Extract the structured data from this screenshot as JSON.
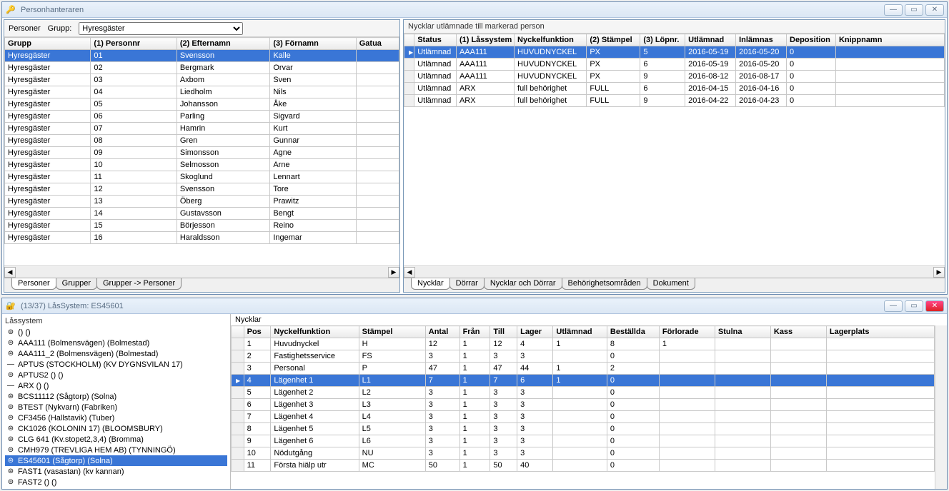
{
  "top_window": {
    "title": "Personhanteraren",
    "toolbar": {
      "personer_label": "Personer",
      "grupp_label": "Grupp:",
      "grupp_selected": "Hyresgäster"
    },
    "persons_table": {
      "headers": [
        "Grupp",
        "(1) Personnr",
        "(2) Efternamn",
        "(3) Förnamn",
        "Gatua"
      ],
      "rows": [
        [
          "Hyresgäster",
          "01",
          "Svensson",
          "Kalle",
          ""
        ],
        [
          "Hyresgäster",
          "02",
          "Bergmark",
          "Orvar",
          ""
        ],
        [
          "Hyresgäster",
          "03",
          "Axbom",
          "Sven",
          ""
        ],
        [
          "Hyresgäster",
          "04",
          "Liedholm",
          "Nils",
          ""
        ],
        [
          "Hyresgäster",
          "05",
          "Johansson",
          "Åke",
          ""
        ],
        [
          "Hyresgäster",
          "06",
          "Parling",
          "Sigvard",
          ""
        ],
        [
          "Hyresgäster",
          "07",
          "Hamrin",
          "Kurt",
          ""
        ],
        [
          "Hyresgäster",
          "08",
          "Gren",
          "Gunnar",
          ""
        ],
        [
          "Hyresgäster",
          "09",
          "Simonsson",
          "Agne",
          ""
        ],
        [
          "Hyresgäster",
          "10",
          "Selmosson",
          "Arne",
          ""
        ],
        [
          "Hyresgäster",
          "11",
          "Skoglund",
          "Lennart",
          ""
        ],
        [
          "Hyresgäster",
          "12",
          "Svensson",
          "Tore",
          ""
        ],
        [
          "Hyresgäster",
          "13",
          "Öberg",
          "Prawitz",
          ""
        ],
        [
          "Hyresgäster",
          "14",
          "Gustavsson",
          "Bengt",
          ""
        ],
        [
          "Hyresgäster",
          "15",
          "Börjesson",
          "Reino",
          ""
        ],
        [
          "Hyresgäster",
          "16",
          "Haraldsson",
          "Ingemar",
          ""
        ]
      ],
      "selected": 0
    },
    "left_tabs": [
      "Personer",
      "Grupper",
      "Grupper -> Personer"
    ],
    "right_title": "Nycklar utlämnade till markerad person",
    "keys_table": {
      "headers": [
        "Status",
        "(1) Låssystem",
        "Nyckelfunktion",
        "(2) Stämpel",
        "(3) Löpnr.",
        "Utlämnad",
        "Inlämnas",
        "Deposition",
        "Knippnamn"
      ],
      "rows": [
        [
          "Utlämnad",
          "AAA111",
          "HUVUDNYCKEL",
          "PX",
          "5",
          "2016-05-19",
          "2016-05-20",
          "0",
          ""
        ],
        [
          "Utlämnad",
          "AAA111",
          "HUVUDNYCKEL",
          "PX",
          "6",
          "2016-05-19",
          "2016-05-20",
          "0",
          ""
        ],
        [
          "Utlämnad",
          "AAA111",
          "HUVUDNYCKEL",
          "PX",
          "9",
          "2016-08-12",
          "2016-08-17",
          "0",
          ""
        ],
        [
          "Utlämnad",
          "ARX",
          "full behörighet",
          "FULL",
          "6",
          "2016-04-15",
          "2016-04-16",
          "0",
          ""
        ],
        [
          "Utlämnad",
          "ARX",
          "full behörighet",
          "FULL",
          "9",
          "2016-04-22",
          "2016-04-23",
          "0",
          ""
        ]
      ],
      "selected": 0
    },
    "right_tabs": [
      "Nycklar",
      "Dörrar",
      "Nycklar och Dörrar",
      "Behörighetsområden",
      "Dokument"
    ]
  },
  "bottom_window": {
    "title": "(13/37) LåsSystem: ES45601",
    "tree": {
      "header": "Låssystem",
      "items": [
        {
          "g": "⊜",
          "label": "() ()"
        },
        {
          "g": "⊜",
          "label": "AAA111 (Bolmensvägen) (Bolmestad)"
        },
        {
          "g": "⊜",
          "label": "AAA111_2 (Bolmensvägen) (Bolmestad)"
        },
        {
          "g": "—",
          "label": "APTUS (STOCKHOLM) (KV DYGNSVILAN 17)"
        },
        {
          "g": "⊜",
          "label": "APTUS2 () ()"
        },
        {
          "g": "—",
          "label": "ARX () ()"
        },
        {
          "g": "⊜",
          "label": "BCS11112 (Sågtorp) (Solna)"
        },
        {
          "g": "⊜",
          "label": "BTEST (Nykvarn) (Fabriken)"
        },
        {
          "g": "⊜",
          "label": "CF3456 (Hallstavik) (Tuber)"
        },
        {
          "g": "⊜",
          "label": "CK1026 (KOLONIN 17) (BLOOMSBURY)"
        },
        {
          "g": "⊜",
          "label": "CLG 641 (Kv.stopet2,3,4) (Bromma)"
        },
        {
          "g": "⊜",
          "label": "CMH979 (TREVLIGA HEM AB) (TYNNINGÖ)"
        },
        {
          "g": "⊜",
          "label": "ES45601 (Sågtorp) (Solna)"
        },
        {
          "g": "⊜",
          "label": "FAST1 (vasastan) (kv kannan)"
        },
        {
          "g": "⊜",
          "label": "FAST2 () ()"
        }
      ],
      "selected": 12
    },
    "keys_header": "Nycklar",
    "key_grid": {
      "headers": [
        "",
        "Pos",
        "Nyckelfunktion",
        "Stämpel",
        "Antal",
        "Från",
        "Till",
        "Lager",
        "Utlämnad",
        "Beställda",
        "Förlorade",
        "Stulna",
        "Kass",
        "Lagerplats"
      ],
      "rows": [
        [
          "",
          "1",
          "Huvudnyckel",
          "H",
          "12",
          "1",
          "12",
          "4",
          "1",
          "8",
          "1",
          "",
          "",
          ""
        ],
        [
          "",
          "2",
          "Fastighetsservice",
          "FS",
          "3",
          "1",
          "3",
          "3",
          "",
          "0",
          "",
          "",
          "",
          ""
        ],
        [
          "",
          "3",
          "Personal",
          "P",
          "47",
          "1",
          "47",
          "44",
          "1",
          "2",
          "",
          "",
          "",
          ""
        ],
        [
          "",
          "4",
          "Lägenhet 1",
          "L1",
          "7",
          "1",
          "7",
          "6",
          "1",
          "0",
          "",
          "",
          "",
          ""
        ],
        [
          "",
          "5",
          "Lägenhet 2",
          "L2",
          "3",
          "1",
          "3",
          "3",
          "",
          "0",
          "",
          "",
          "",
          ""
        ],
        [
          "",
          "6",
          "Lägenhet 3",
          "L3",
          "3",
          "1",
          "3",
          "3",
          "",
          "0",
          "",
          "",
          "",
          ""
        ],
        [
          "",
          "7",
          "Lägenhet 4",
          "L4",
          "3",
          "1",
          "3",
          "3",
          "",
          "0",
          "",
          "",
          "",
          ""
        ],
        [
          "",
          "8",
          "Lägenhet 5",
          "L5",
          "3",
          "1",
          "3",
          "3",
          "",
          "0",
          "",
          "",
          "",
          ""
        ],
        [
          "",
          "9",
          "Lägenhet 6",
          "L6",
          "3",
          "1",
          "3",
          "3",
          "",
          "0",
          "",
          "",
          "",
          ""
        ],
        [
          "",
          "10",
          "Nödutgång",
          "NU",
          "3",
          "1",
          "3",
          "3",
          "",
          "0",
          "",
          "",
          "",
          ""
        ],
        [
          "",
          "11",
          "Första hiälp utr",
          "MC",
          "50",
          "1",
          "50",
          "40",
          "",
          "0",
          "",
          "",
          "",
          ""
        ]
      ],
      "selected": 3
    }
  }
}
